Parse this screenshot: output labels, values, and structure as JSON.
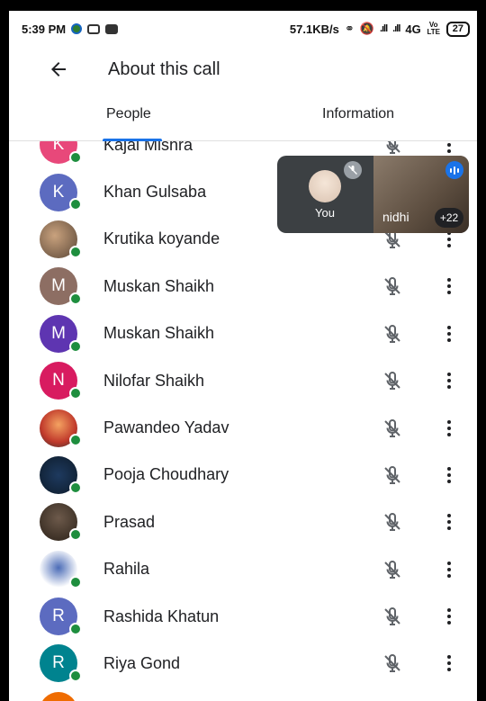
{
  "status_bar": {
    "time": "5:39 PM",
    "speed": "57.1KB/s",
    "network": "4G",
    "volte": "Vo LTE",
    "battery": "27"
  },
  "header": {
    "title": "About this call"
  },
  "tabs": [
    {
      "label": "People",
      "active": true
    },
    {
      "label": "Information",
      "active": false
    }
  ],
  "floating_tiles": {
    "self_label": "You",
    "other_label": "nidhi",
    "extra_count": "+22"
  },
  "participants": [
    {
      "name": "Kajal Mishra",
      "initial": "K",
      "color": "#e8487a",
      "photo": ""
    },
    {
      "name": "Khan Gulsaba",
      "initial": "K",
      "color": "#5c6bc0",
      "photo": ""
    },
    {
      "name": "Krutika koyande",
      "initial": "",
      "color": "",
      "photo": "photo"
    },
    {
      "name": "Muskan Shaikh",
      "initial": "M",
      "color": "#8d6e63",
      "photo": ""
    },
    {
      "name": "Muskan Shaikh",
      "initial": "M",
      "color": "#5e35b1",
      "photo": ""
    },
    {
      "name": "Nilofar Shaikh",
      "initial": "N",
      "color": "#d81b60",
      "photo": ""
    },
    {
      "name": "Pawandeo Yadav",
      "initial": "",
      "color": "",
      "photo": "photo2"
    },
    {
      "name": "Pooja Choudhary",
      "initial": "",
      "color": "",
      "photo": "photo3"
    },
    {
      "name": "Prasad",
      "initial": "",
      "color": "",
      "photo": "photo4"
    },
    {
      "name": "Rahila",
      "initial": "",
      "color": "",
      "photo": "photo5"
    },
    {
      "name": "Rashida Khatun",
      "initial": "R",
      "color": "#5c6bc0",
      "photo": ""
    },
    {
      "name": "Riya Gond",
      "initial": "R",
      "color": "#00838f",
      "photo": ""
    },
    {
      "name": "",
      "initial": "",
      "color": "#ef6c00",
      "photo": ""
    }
  ]
}
